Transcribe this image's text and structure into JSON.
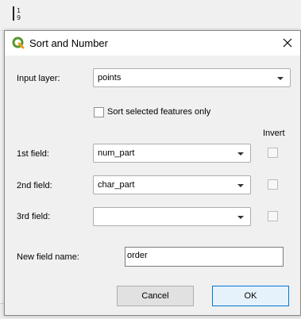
{
  "dialog": {
    "title": "Sort and Number",
    "input_layer": {
      "label": "Input layer:",
      "value": "points"
    },
    "sort_selected": {
      "label": "Sort selected features only",
      "checked": false
    },
    "invert_header": "Invert",
    "fields": [
      {
        "label": "1st field:",
        "value": "num_part",
        "invert": false
      },
      {
        "label": "2nd field:",
        "value": "char_part",
        "invert": false
      },
      {
        "label": "3rd field:",
        "value": "",
        "invert": false
      }
    ],
    "new_field": {
      "label": "New field name:",
      "value": "order"
    },
    "buttons": {
      "cancel": "Cancel",
      "ok": "OK"
    }
  },
  "colors": {
    "qgis_green": "#589632",
    "ok_border": "#0078d7"
  },
  "icons": [
    "qgis-icon",
    "close-icon",
    "dropdown-arrow-icon",
    "sort-number-icon"
  ]
}
